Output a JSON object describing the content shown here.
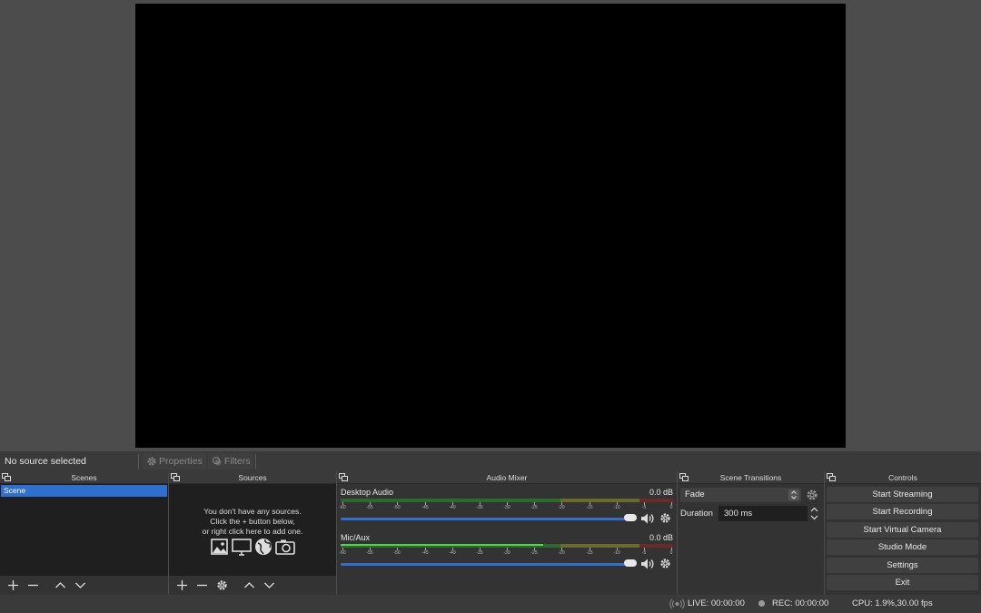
{
  "context_bar": {
    "no_source": "No source selected",
    "properties_label": "Properties",
    "filters_label": "Filters"
  },
  "scenes": {
    "title": "Scenes",
    "items": [
      {
        "label": "Scene",
        "selected": true
      }
    ]
  },
  "sources": {
    "title": "Sources",
    "empty_line1": "You don't have any sources.",
    "empty_line2": "Click the + button below,",
    "empty_line3": "or right click here to add one."
  },
  "mixer": {
    "title": "Audio Mixer",
    "channels": [
      {
        "name": "Desktop Audio",
        "db": "0.0 dB",
        "level": 0.0
      },
      {
        "name": "Mic/Aux",
        "db": "0.0 dB",
        "level": 0.61
      }
    ],
    "tick_labels": [
      "-60",
      "-55",
      "-50",
      "-45",
      "-40",
      "-35",
      "-30",
      "-25",
      "-20",
      "-15",
      "-10",
      "-5",
      "0"
    ]
  },
  "transitions": {
    "title": "Scene Transitions",
    "selected": "Fade",
    "duration_label": "Duration",
    "duration_value": "300 ms"
  },
  "controls": {
    "title": "Controls",
    "start_streaming": "Start Streaming",
    "start_recording": "Start Recording",
    "start_virtual_camera": "Start Virtual Camera",
    "studio_mode": "Studio Mode",
    "settings": "Settings",
    "exit": "Exit"
  },
  "status": {
    "live": "LIVE: 00:00:00",
    "rec": "REC: 00:00:00",
    "cpu": "CPU: 1.9%,30.00 fps"
  },
  "colors": {
    "accent": "#2e6fd0",
    "meter_green": "#4cd64c"
  }
}
